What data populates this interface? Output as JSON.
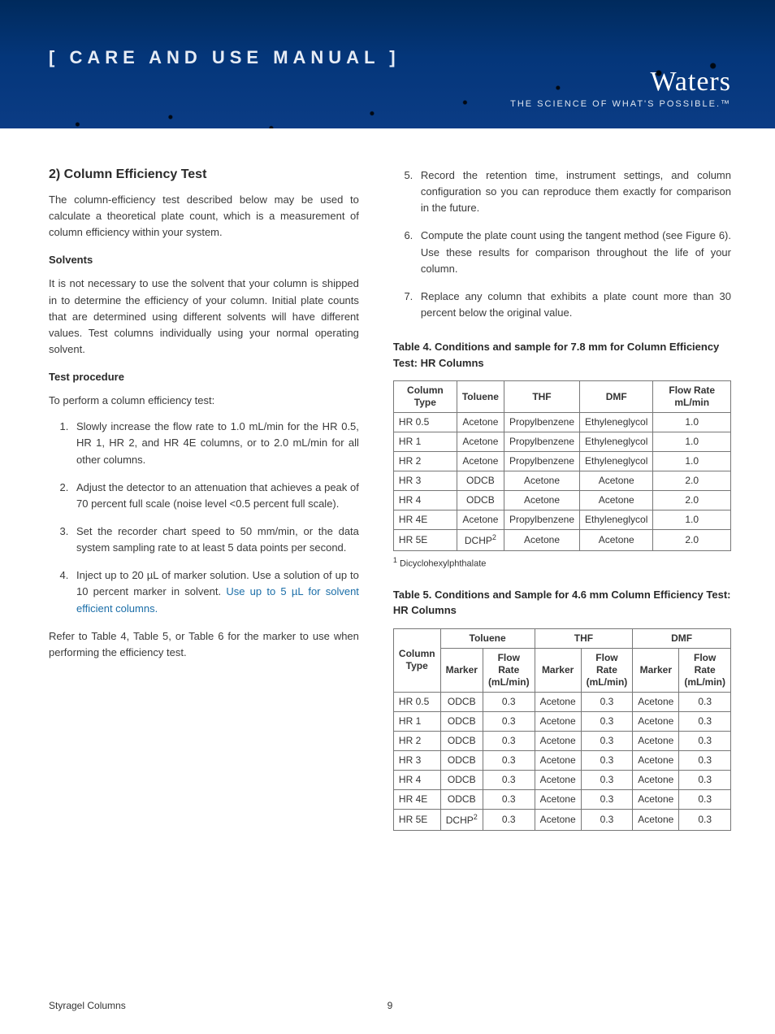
{
  "banner": {
    "title": "[ CARE AND USE MANUAL ]",
    "brand_name": "Waters",
    "brand_tag": "THE SCIENCE OF WHAT'S POSSIBLE.™"
  },
  "left": {
    "heading": "2) Column Efficiency Test",
    "intro": "The column-efficiency test described below may be used to calculate a theoretical plate count, which is a measurement of column efficiency within your system.",
    "solvents_h": "Solvents",
    "solvents_p": "It is not necessary to use the solvent that your column is shipped in to determine the efficiency of your column. Initial plate counts that are determined using different solvents will have different values. Test columns individually using your normal operating solvent.",
    "proc_h": "Test procedure",
    "proc_intro": "To perform a column efficiency test:",
    "steps": [
      "Slowly increase the flow rate to 1.0 mL/min for the HR 0.5, HR 1, HR 2, and HR 4E columns, or to 2.0 mL/min for all other columns.",
      "Adjust the detector to an attenuation that achieves a peak of 70 percent full scale (noise level <0.5 percent full scale).",
      "Set the recorder chart speed to 50 mm/min, or the data system sampling rate to at least 5 data points per second.",
      "Inject up to 20 µL of marker solution. Use a solution of up to 10 percent marker in solvent."
    ],
    "step4_link": "Use up to 5 µL for solvent efficient columns.",
    "after_steps": "Refer to Table 4, Table 5, or Table 6 for the marker to use when performing the efficiency test."
  },
  "right": {
    "steps": [
      {
        "n": "5.",
        "t": "Record the retention time, instrument settings, and column configuration so you can reproduce them exactly for comparison in the future."
      },
      {
        "n": "6.",
        "t": "Compute the plate count using the tangent method (see Figure 6). Use these results for comparison throughout the life of your column."
      },
      {
        "n": "7.",
        "t": "Replace any column that exhibits a plate count more than 30 percent below the original value."
      }
    ],
    "table4_title": "Table 4. Conditions and sample for 7.8 mm for Column Efficiency Test: HR Columns",
    "table4_head": [
      "Column Type",
      "Toluene",
      "THF",
      "DMF",
      "Flow Rate mL/min"
    ],
    "table4_rows": [
      [
        "HR 0.5",
        "Acetone",
        "Propylbenzene",
        "Ethyleneglycol",
        "1.0"
      ],
      [
        "HR 1",
        "Acetone",
        "Propylbenzene",
        "Ethyleneglycol",
        "1.0"
      ],
      [
        "HR 2",
        "Acetone",
        "Propylbenzene",
        "Ethyleneglycol",
        "1.0"
      ],
      [
        "HR 3",
        "ODCB",
        "Acetone",
        "Acetone",
        "2.0"
      ],
      [
        "HR 4",
        "ODCB",
        "Acetone",
        "Acetone",
        "2.0"
      ],
      [
        "HR 4E",
        "Acetone",
        "Propylbenzene",
        "Ethyleneglycol",
        "1.0"
      ],
      [
        "HR 5E",
        "DCHP",
        "Acetone",
        "Acetone",
        "2.0"
      ]
    ],
    "footnote_sup": "1",
    "footnote_text": "Dicyclohexylphthalate",
    "table5_title": "Table 5. Conditions and Sample for 4.6 mm Column Efficiency Test: HR Columns",
    "table5_group_head": [
      "Toluene",
      "THF",
      "DMF"
    ],
    "table5_sub_head": [
      "Column Type",
      "Marker",
      "Flow Rate (mL/min)",
      "Marker",
      "Flow Rate (mL/min)",
      "Marker",
      "Flow Rate (mL/min)"
    ],
    "table5_rows": [
      [
        "HR 0.5",
        "ODCB",
        "0.3",
        "Acetone",
        "0.3",
        "Acetone",
        "0.3"
      ],
      [
        "HR 1",
        "ODCB",
        "0.3",
        "Acetone",
        "0.3",
        "Acetone",
        "0.3"
      ],
      [
        "HR 2",
        "ODCB",
        "0.3",
        "Acetone",
        "0.3",
        "Acetone",
        "0.3"
      ],
      [
        "HR 3",
        "ODCB",
        "0.3",
        "Acetone",
        "0.3",
        "Acetone",
        "0.3"
      ],
      [
        "HR 4",
        "ODCB",
        "0.3",
        "Acetone",
        "0.3",
        "Acetone",
        "0.3"
      ],
      [
        "HR 4E",
        "ODCB",
        "0.3",
        "Acetone",
        "0.3",
        "Acetone",
        "0.3"
      ],
      [
        "HR 5E",
        "DCHP",
        "0.3",
        "Acetone",
        "0.3",
        "Acetone",
        "0.3"
      ]
    ],
    "dchp_sup": "2"
  },
  "footer": {
    "left": "Styragel Columns",
    "center": "9"
  }
}
